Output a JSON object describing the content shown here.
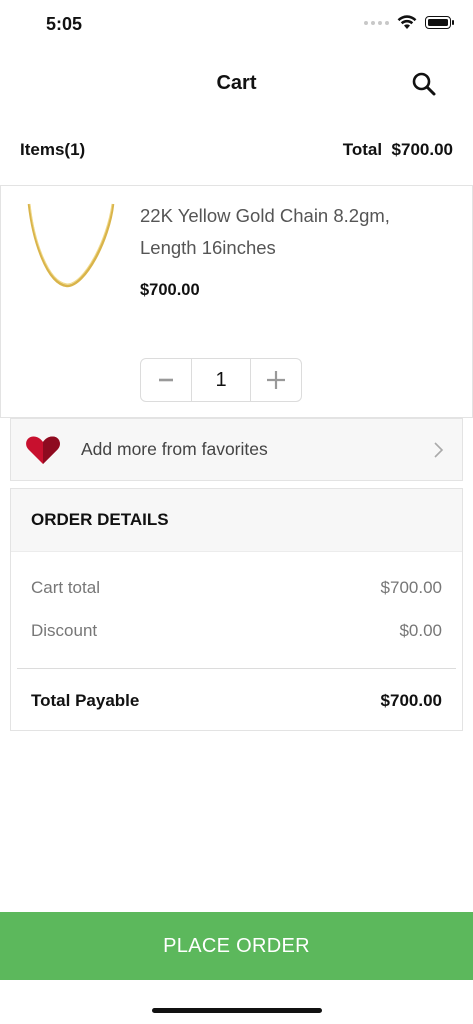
{
  "status_bar": {
    "time": "5:05"
  },
  "header": {
    "title": "Cart",
    "search_icon": "search-icon"
  },
  "summary": {
    "items_label": "Items(1)",
    "total_label": "Total",
    "total_value": "$700.00"
  },
  "cart_item": {
    "name": "22K Yellow Gold Chain 8.2gm, Length 16inches",
    "price": "$700.00",
    "quantity": "1",
    "image_icon": "gold-chain-image"
  },
  "favorites": {
    "label": "Add more from favorites",
    "icon": "heart-icon"
  },
  "order_details": {
    "title": "ORDER DETAILS",
    "cart_total_label": "Cart total",
    "cart_total_value": "$700.00",
    "discount_label": "Discount",
    "discount_value": "$0.00",
    "total_payable_label": "Total Payable",
    "total_payable_value": "$700.00"
  },
  "cta": {
    "place_order_label": "PLACE ORDER"
  },
  "colors": {
    "accent_green": "#5cb85c",
    "heart_red": "#c8102e",
    "gold": "#d9b44a"
  }
}
